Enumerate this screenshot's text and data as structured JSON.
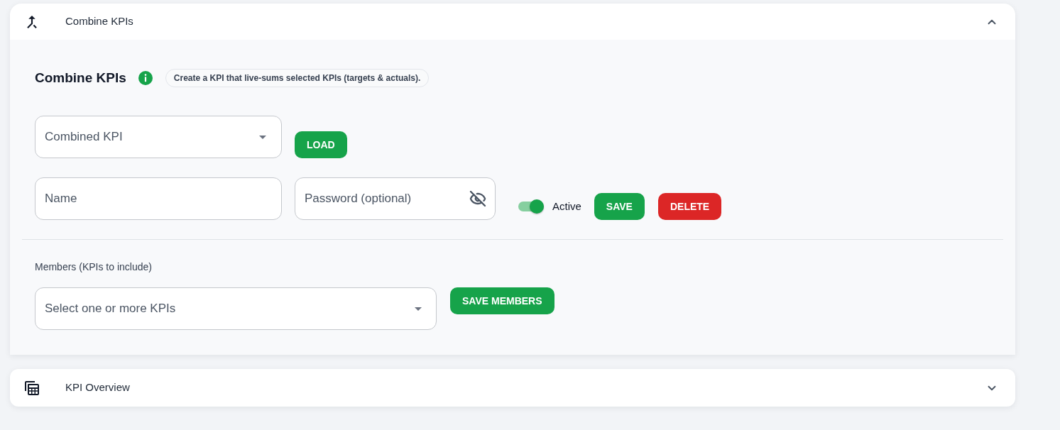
{
  "sections": [
    {
      "kind": "merge",
      "title": "Combine KPIs",
      "expanded": true,
      "content": {
        "heading": "Combine KPIs",
        "info_chip": "Create a KPI that live-sums selected KPIs (targets & actuals).",
        "kpi_select": {
          "placeholder": "Combined KPI"
        },
        "load_button": "LOAD",
        "name_field": {
          "placeholder": "Name"
        },
        "password_field": {
          "placeholder": "Password (optional)"
        },
        "active_toggle": {
          "label": "Active",
          "on": true
        },
        "save_button": "SAVE",
        "delete_button": "DELETE",
        "members": {
          "label": "Members (KPIs to include)",
          "select": {
            "placeholder": "Select one or more KPIs"
          },
          "button": "SAVE MEMBERS"
        }
      }
    },
    {
      "kind": "grid",
      "title": "KPI Overview",
      "expanded": false
    }
  ]
}
